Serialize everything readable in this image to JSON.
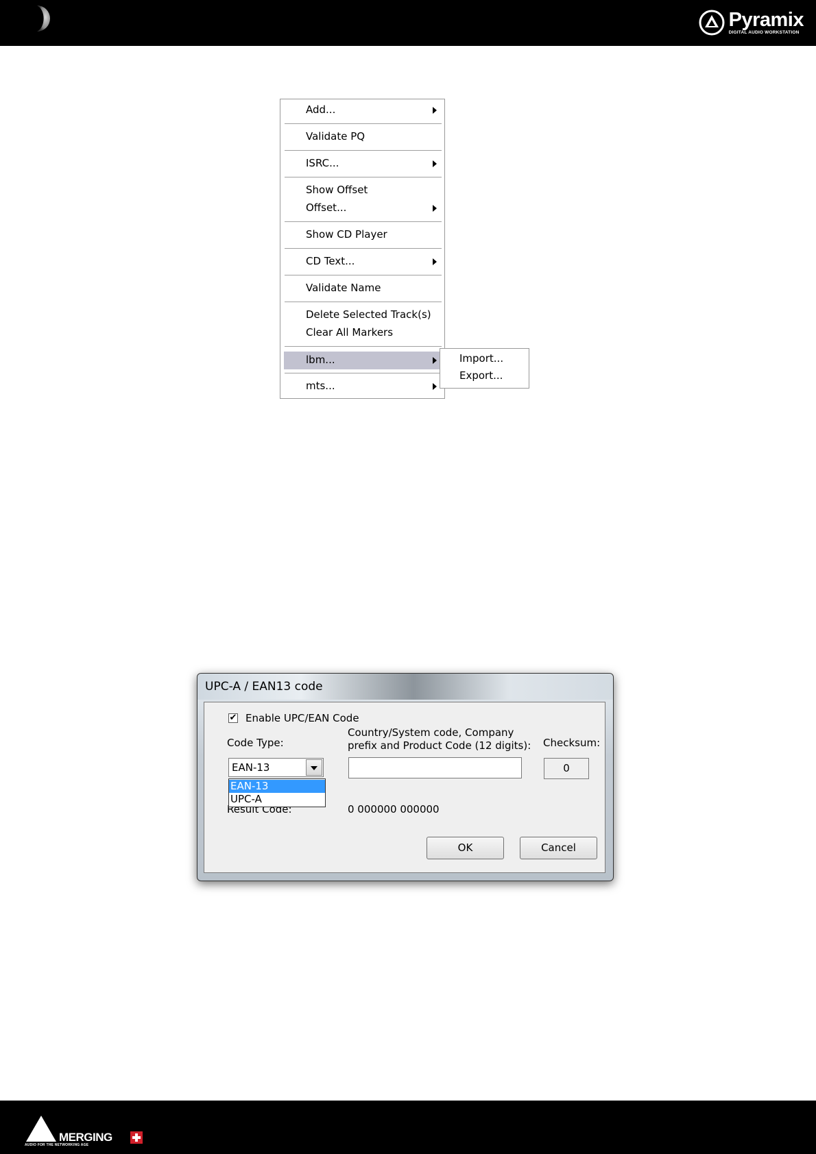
{
  "header": {
    "logo_name": "Pyramix",
    "logo_tagline": "DIGITAL AUDIO WORKSTATION",
    "moon_icon": "moon-icon"
  },
  "context_menu": {
    "items": [
      {
        "label": "Add...",
        "submenu": true
      },
      {
        "label": "Validate PQ",
        "submenu": false
      },
      {
        "label": "ISRC...",
        "submenu": true
      },
      {
        "label": "Show Offset",
        "submenu": false
      },
      {
        "label": "Offset...",
        "submenu": true
      },
      {
        "label": "Show CD Player",
        "submenu": false
      },
      {
        "label": "CD Text...",
        "submenu": true
      },
      {
        "label": "Validate Name",
        "submenu": false
      },
      {
        "label": "Delete Selected Track(s)",
        "submenu": false
      },
      {
        "label": "Clear All Markers",
        "submenu": false
      },
      {
        "label": "lbm...",
        "submenu": true,
        "highlighted": true
      },
      {
        "label": "mts...",
        "submenu": true
      }
    ],
    "submenu": {
      "items": [
        "Import...",
        "Export..."
      ]
    }
  },
  "dialog": {
    "title": "UPC-A / EAN13 code",
    "enable_label": "Enable UPC/EAN Code",
    "enable_checked": true,
    "enable_check_glyph": "✔",
    "code_type_label": "Code Type:",
    "code_type_value": "EAN-13",
    "code_type_options": [
      "EAN-13",
      "UPC-A"
    ],
    "country_label_line1": "Country/System code, Company",
    "country_label_line2": "prefix and Product Code (12 digits):",
    "code_input_value": "",
    "checksum_label": "Checksum:",
    "checksum_value": "0",
    "result_label": "Result Code:",
    "result_value": "0 000000 000000",
    "ok_label": "OK",
    "cancel_label": "Cancel"
  },
  "footer": {
    "brand_name": "MERGING",
    "brand_tagline": "AUDIO FOR THE NETWORKING AGE"
  },
  "colors": {
    "menu_highlight": "#c2c2d0",
    "dropdown_selection": "#3399ff",
    "header_background": "#000000",
    "brand_red": "#d0202a"
  }
}
